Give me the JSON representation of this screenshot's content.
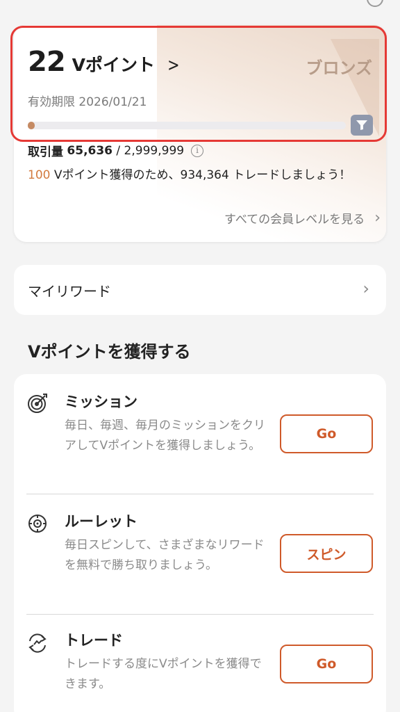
{
  "points_card": {
    "points_value": "22",
    "points_unit": "Vポイント",
    "tier": "ブロンズ",
    "expiry": "有効期限 2026/01/21",
    "progress": 0.02,
    "volume_label": "取引量",
    "volume_current": "65,636",
    "volume_target": "/ 2,999,999",
    "goal_points": "100",
    "goal_text": " Vポイント獲得のため、",
    "goal_amount": "934,364",
    "goal_suffix": " トレードしましょう！",
    "all_levels_link": "すべての会員レベルを見る"
  },
  "my_rewards": {
    "label": "マイリワード"
  },
  "earn_section": {
    "title": "Vポイントを獲得する",
    "items": [
      {
        "title": "ミッション",
        "description": "毎日、毎週、毎月のミッションをクリアしてVポイントを獲得しましょう。",
        "button": "Go",
        "icon": "target-icon"
      },
      {
        "title": "ルーレット",
        "description": "毎日スピンして、さまざまなリワードを無料で勝ち取りましょう。",
        "button": "スピン",
        "icon": "roulette-icon"
      },
      {
        "title": "トレード",
        "description": "トレードする度にVポイントを獲得できます。",
        "button": "Go",
        "icon": "trade-icon"
      }
    ]
  },
  "colors": {
    "accent": "#cf5a2a",
    "highlight": "#e53935",
    "tier": "#b79c89"
  }
}
